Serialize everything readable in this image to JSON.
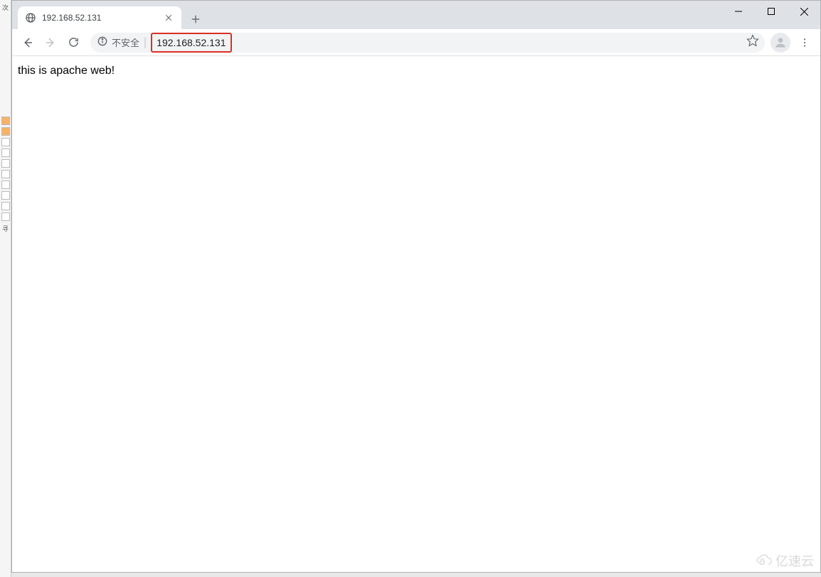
{
  "tab": {
    "title": "192.168.52.131",
    "favicon": "globe-icon"
  },
  "address_bar": {
    "security_label": "不安全",
    "url": "192.168.52.131"
  },
  "page": {
    "content": "this is apache web!"
  },
  "watermark": {
    "text": "亿速云"
  },
  "colors": {
    "highlight_border": "#d93025",
    "tab_strip_bg": "#dee1e6",
    "url_bg": "#f1f3f4"
  }
}
